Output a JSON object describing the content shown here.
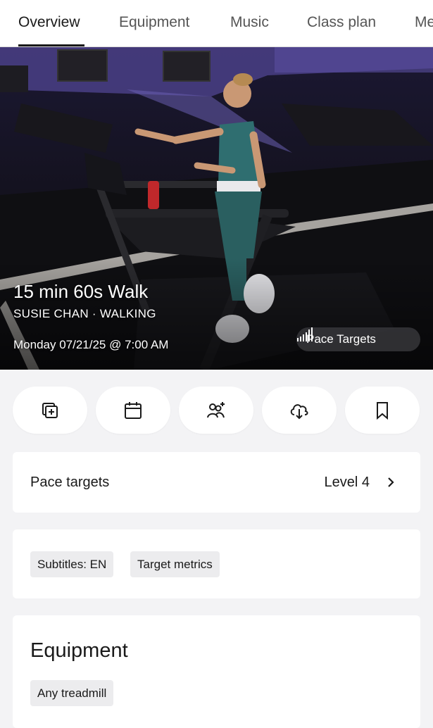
{
  "tabs": [
    "Overview",
    "Equipment",
    "Music",
    "Class plan",
    "Me"
  ],
  "active_tab": "Overview",
  "hero": {
    "title": "15 min 60s Walk",
    "subtitle": "SUSIE CHAN · WALKING",
    "datetime": "Monday 07/21/25 @ 7:00 AM",
    "pill_label": "Pace Targets",
    "pill_icon": "signal-bars-icon"
  },
  "actions": [
    {
      "name": "add-to-stack-button",
      "icon": "stack-plus-icon"
    },
    {
      "name": "schedule-button",
      "icon": "calendar-icon"
    },
    {
      "name": "invite-friends-button",
      "icon": "add-people-icon"
    },
    {
      "name": "download-button",
      "icon": "cloud-download-icon"
    },
    {
      "name": "bookmark-button",
      "icon": "bookmark-icon"
    }
  ],
  "pace_targets": {
    "label": "Pace targets",
    "value": "Level 4"
  },
  "tags": [
    "Subtitles: EN",
    "Target metrics"
  ],
  "equipment": {
    "title": "Equipment",
    "items": [
      "Any treadmill"
    ]
  },
  "colors": {
    "accent_dark": "#1a1a1a",
    "background": "#f3f3f5",
    "card": "#ffffff",
    "tag_bg": "#ececee"
  }
}
